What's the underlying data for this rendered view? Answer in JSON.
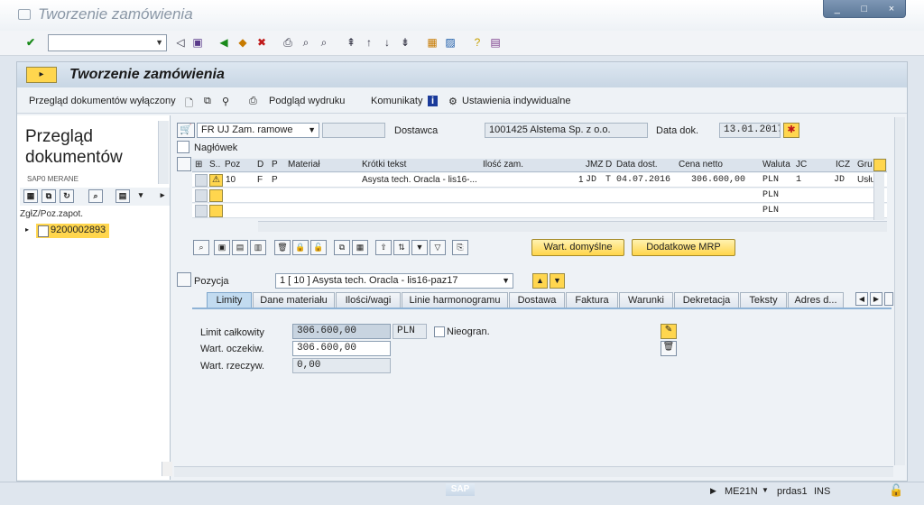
{
  "window": {
    "title": "Tworzenie zamówienia",
    "controls": [
      "_",
      "□",
      "×"
    ]
  },
  "toolbar": {
    "command_field": "",
    "dropdown_glyph": "▼"
  },
  "app": {
    "title": "Tworzenie zamówienia"
  },
  "app_toolbar": {
    "doc_overview": "Przegląd dokumentów wyłączony",
    "print_preview": "Podgląd wydruku",
    "messages": "Komunikaty",
    "personal_settings": "Ustawienia indywidualne"
  },
  "left": {
    "title": "Przegląd dokumentów",
    "small_label": "SAP0 MERANE",
    "tree_header": "ZgłZ/Poz.zapot.",
    "tree_item": "9200002893"
  },
  "header": {
    "doc_type": "FR UJ Zam. ramowe",
    "doc_number": "",
    "vendor_label": "Dostawca",
    "vendor_value": "1001425 Alstema Sp. z o.o.",
    "doc_date_label": "Data dok.",
    "doc_date_value": "13.01.2017",
    "header_toggle": "Nagłówek"
  },
  "grid": {
    "columns": [
      "S..",
      "Poz",
      "D",
      "P",
      "Materiał",
      "Krótki tekst",
      "Ilość zam.",
      "JMZ",
      "D",
      "Data dost.",
      "Cena netto",
      "Waluta",
      "JC",
      "ICZ",
      "Gru"
    ],
    "row1": {
      "poz": "10",
      "d": "F",
      "p": "P",
      "material": "",
      "short_text": "Asysta tech. Oracla - lis16-...",
      "qty": "1",
      "unit": "JD",
      "dcat": "T",
      "delivery": "04.07.2016",
      "price": "306.600,00",
      "currency": "PLN",
      "jc": "1",
      "icz": "JD",
      "gru": "Usłu"
    },
    "row2": {
      "currency": "PLN"
    },
    "row3": {
      "currency": "PLN"
    }
  },
  "buttons": {
    "defaults": "Wart. domyślne",
    "mrp": "Dodatkowe MRP"
  },
  "item": {
    "label": "Pozycja",
    "value": "1 [ 10 ] Asysta tech. Oracla - lis16-paz17"
  },
  "tabs": [
    "Limity",
    "Dane materiału",
    "Ilości/wagi",
    "Linie harmonogramu",
    "Dostawa",
    "Faktura",
    "Warunki",
    "Dekretacja",
    "Teksty",
    "Adres d..."
  ],
  "limits": {
    "total_label": "Limit całkowity",
    "total_value": "306.600,00",
    "currency": "PLN",
    "unlimited": "Nieogran.",
    "expected_label": "Wart. oczekiw.",
    "expected_value": "306.600,00",
    "actual_label": "Wart. rzeczyw.",
    "actual_value": "0,00"
  },
  "status": {
    "tcode": "ME21N",
    "server": "prdas1",
    "mode": "INS",
    "logo": "SAP"
  }
}
